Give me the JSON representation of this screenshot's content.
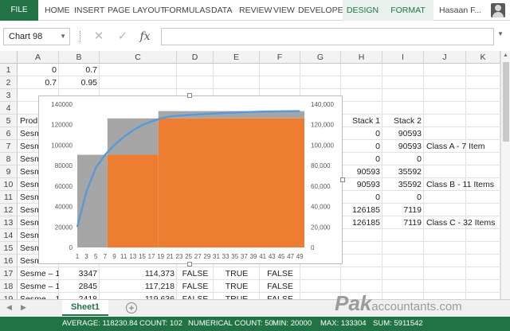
{
  "ribbon": {
    "file": "FILE",
    "tabs": [
      "HOME",
      "INSERT",
      "PAGE LAYOUT",
      "FORMULAS",
      "DATA",
      "REVIEW",
      "VIEW",
      "DEVELOPER"
    ],
    "context_tabs": [
      "DESIGN",
      "FORMAT"
    ],
    "user": "Hasaan F..."
  },
  "formula_bar": {
    "name_box": "Chart 98",
    "cancel_icon": "cancel-icon",
    "enter_icon": "check-icon",
    "fx": "fx",
    "value": ""
  },
  "columns": [
    "A",
    "B",
    "C",
    "D",
    "E",
    "F",
    "G",
    "H",
    "I",
    "J",
    "K"
  ],
  "rows": [
    "1",
    "2",
    "3",
    "4",
    "5",
    "6",
    "7",
    "8",
    "9",
    "10",
    "11",
    "12",
    "13",
    "14",
    "15",
    "16",
    "17",
    "18",
    "19"
  ],
  "cells": {
    "a1": "0",
    "b1": "0.7",
    "a2": "0.7",
    "b2": "0.95",
    "a5": "Prod",
    "a6": "Sesm",
    "a7": "Sesm",
    "a8": "Sesm",
    "a9": "Sesm",
    "a10": "Sesm",
    "a11": "Sesm",
    "a12": "Sesm",
    "a13": "Sesm",
    "a14": "Sesm",
    "a15": "Sesm",
    "a16": "Sesm",
    "h5": "Stack 1",
    "i5": "Stack 2",
    "h6": "0",
    "i6": "90593",
    "h7": "0",
    "i7": "90593",
    "j7": "Class A - 7 Item",
    "h8": "0",
    "i8": "0",
    "h9": "90593",
    "i9": "35592",
    "h10": "90593",
    "i10": "35592",
    "j10": "Class B - 11 Items",
    "h11": "0",
    "i11": "0",
    "h12": "126185",
    "i12": "7119",
    "h13": "126185",
    "i13": "7119",
    "j13": "Class C - 32 Items",
    "a17": "Sesme – 1",
    "b17": "3347",
    "c17": "114,373",
    "d17": "FALSE",
    "e17": "TRUE",
    "f17": "FALSE",
    "a18": "Sesme – 1",
    "b18": "2845",
    "c18": "117,218",
    "d18": "FALSE",
    "e18": "TRUE",
    "f18": "FALSE",
    "a19": "Sesme – 1",
    "b19": "2418",
    "c19": "119,636",
    "d19": "FALSE",
    "e19": "TRUE",
    "f19": "FALSE"
  },
  "chart_data": {
    "type": "area",
    "left_axis": {
      "min": 0,
      "max": 140000,
      "ticks": [
        "0",
        "20000",
        "40000",
        "60000",
        "80000",
        "100000",
        "120000",
        "140000"
      ]
    },
    "right_axis": {
      "min": 0,
      "max": 140000,
      "ticks": [
        "0",
        "20,000",
        "40,000",
        "60,000",
        "80,000",
        "100,000",
        "120,000",
        "140,000"
      ]
    },
    "x_ticks": [
      "1",
      "3",
      "5",
      "7",
      "9",
      "11",
      "13",
      "15",
      "17",
      "19",
      "21",
      "23",
      "25",
      "27",
      "29",
      "31",
      "33",
      "35",
      "37",
      "39",
      "41",
      "43",
      "45",
      "47",
      "49"
    ],
    "x_range": [
      1,
      50
    ],
    "stacked_series": [
      {
        "color": "#a6a6a6",
        "segments": [
          {
            "from": 1,
            "to": 7.5,
            "bottom": 0,
            "top": 90593
          },
          {
            "from": 7.5,
            "to": 18.5,
            "bottom": 90593,
            "top": 126185
          },
          {
            "from": 18.5,
            "to": 50,
            "bottom": 126185,
            "top": 133304
          }
        ]
      },
      {
        "color": "#ed7d31",
        "segments": [
          {
            "from": 7.5,
            "to": 18.5,
            "bottom": 0,
            "top": 90593
          },
          {
            "from": 18.5,
            "to": 50,
            "bottom": 0,
            "top": 126185
          }
        ]
      }
    ],
    "line": {
      "color": "#5b9bd5",
      "x": [
        1,
        3,
        5,
        7,
        9,
        11,
        13,
        15,
        17,
        19,
        21,
        25,
        29,
        33,
        37,
        41,
        45,
        49
      ],
      "y": [
        20000,
        55000,
        78000,
        90593,
        100000,
        108000,
        114373,
        119636,
        123000,
        126185,
        128000,
        129500,
        130500,
        131500,
        132200,
        132800,
        133100,
        133304
      ]
    }
  },
  "sheet_tabs": {
    "active": "Sheet1",
    "add": "+"
  },
  "watermark": {
    "pak": "Pak",
    "acc": "accountants.com"
  },
  "status": {
    "average": "AVERAGE: 118230.84",
    "count": "COUNT: 102",
    "numerical_count": "NUMERICAL COUNT: 50",
    "min": "MIN: 20000",
    "max": "MAX: 133304",
    "sum": "SUM: 5911542"
  },
  "colors": {
    "excel_green": "#217346",
    "gray_area": "#a6a6a6",
    "orange_area": "#ed7d31",
    "line_blue": "#5b9bd5"
  }
}
